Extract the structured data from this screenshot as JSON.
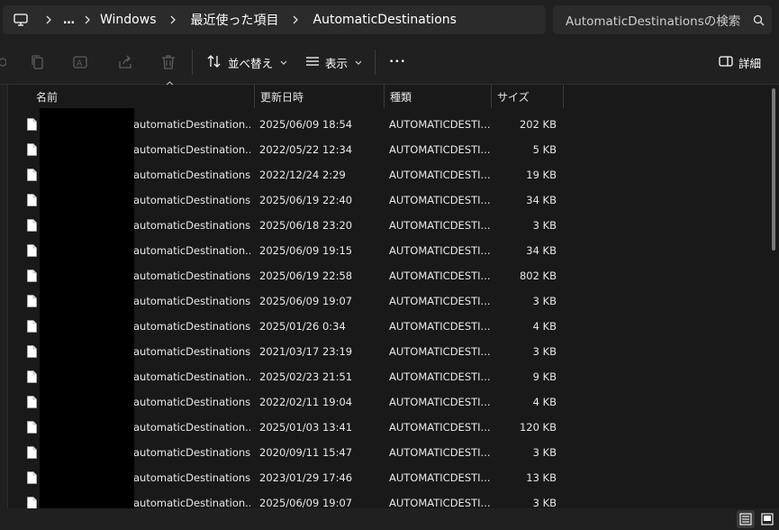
{
  "address": {
    "more": "…",
    "crumbs": [
      "Windows",
      "最近使った項目",
      "AutomaticDestinations"
    ]
  },
  "search": {
    "placeholder": "AutomaticDestinationsの検索"
  },
  "toolbar": {
    "sort_label": "並べ替え",
    "view_label": "表示",
    "more_label": "•••",
    "details_label": "詳細"
  },
  "columns": {
    "name": "名前",
    "date": "更新日時",
    "type": "種類",
    "size": "サイズ"
  },
  "files": [
    {
      "name": "automaticDestination...",
      "date": "2025/06/09 18:54",
      "type": "AUTOMATICDESTI...",
      "size": "202 KB"
    },
    {
      "name": "automaticDestination...",
      "date": "2022/05/22 12:34",
      "type": "AUTOMATICDESTI...",
      "size": "5 KB"
    },
    {
      "name": "automaticDestinations...",
      "date": "2022/12/24 2:29",
      "type": "AUTOMATICDESTI...",
      "size": "19 KB"
    },
    {
      "name": "automaticDestinations...",
      "date": "2025/06/19 22:40",
      "type": "AUTOMATICDESTI...",
      "size": "34 KB"
    },
    {
      "name": "automaticDestinations-...",
      "date": "2025/06/18 23:20",
      "type": "AUTOMATICDESTI...",
      "size": "3 KB"
    },
    {
      "name": "automaticDestination...",
      "date": "2025/06/09 19:15",
      "type": "AUTOMATICDESTI...",
      "size": "34 KB"
    },
    {
      "name": "automaticDestinations...",
      "date": "2025/06/19 22:58",
      "type": "AUTOMATICDESTI...",
      "size": "802 KB"
    },
    {
      "name": "automaticDestinations-...",
      "date": "2025/06/09 19:07",
      "type": "AUTOMATICDESTI...",
      "size": "3 KB"
    },
    {
      "name": "automaticDestinations...",
      "date": "2025/01/26 0:34",
      "type": "AUTOMATICDESTI...",
      "size": "4 KB"
    },
    {
      "name": "automaticDestinations...",
      "date": "2021/03/17 23:19",
      "type": "AUTOMATICDESTI...",
      "size": "3 KB"
    },
    {
      "name": "automaticDestination...",
      "date": "2025/02/23 21:51",
      "type": "AUTOMATICDESTI...",
      "size": "9 KB"
    },
    {
      "name": "automaticDestinations...",
      "date": "2022/02/11 19:04",
      "type": "AUTOMATICDESTI...",
      "size": "4 KB"
    },
    {
      "name": "automaticDestination...",
      "date": "2025/01/03 13:41",
      "type": "AUTOMATICDESTI...",
      "size": "120 KB"
    },
    {
      "name": "automaticDestinations...",
      "date": "2020/09/11 15:47",
      "type": "AUTOMATICDESTI...",
      "size": "3 KB"
    },
    {
      "name": "automaticDestinations...",
      "date": "2023/01/29 17:46",
      "type": "AUTOMATICDESTI...",
      "size": "13 KB"
    },
    {
      "name": "automaticDestination...",
      "date": "2025/06/09 19:07",
      "type": "AUTOMATICDESTI...",
      "size": "3 KB"
    }
  ],
  "icons": {
    "pc": "monitor-icon",
    "search": "search-icon",
    "copy": "copy-icon",
    "rename": "rename-icon",
    "share": "share-icon",
    "delete": "trash-icon",
    "sort": "sort-icon",
    "view": "view-icon",
    "details": "details-pane-icon",
    "file": "file-icon",
    "details_view": "details-view-icon",
    "tiles_view": "tiles-view-icon"
  },
  "colors": {
    "background": "#191919",
    "chrome": "#202020",
    "text": "#ffffff"
  }
}
